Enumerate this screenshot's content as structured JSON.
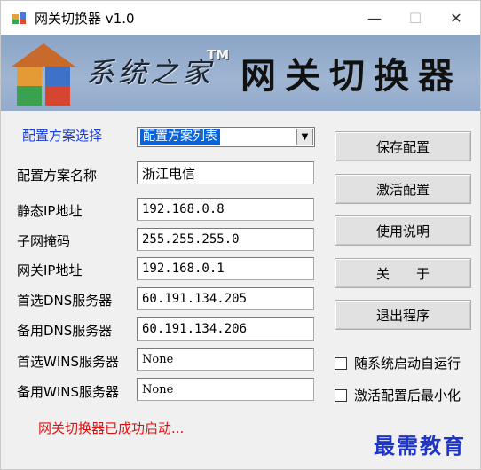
{
  "window": {
    "title": "网关切换器 v1.0",
    "controls": {
      "minimize": "—",
      "maximize": "☐",
      "close": "✕"
    }
  },
  "banner": {
    "brand": "系统之家",
    "tm": "TM",
    "title": "网关切换器"
  },
  "form": {
    "scheme_select_label": "配置方案选择",
    "scheme_select_value": "配置方案列表",
    "fields": [
      {
        "label": "配置方案名称",
        "value": "浙江电信"
      },
      {
        "label": "静态IP地址",
        "value": "192.168.0.8"
      },
      {
        "label": "子网掩码",
        "value": "255.255.255.0"
      },
      {
        "label": "网关IP地址",
        "value": "192.168.0.1"
      },
      {
        "label": "首选DNS服务器",
        "value": "60.191.134.205"
      },
      {
        "label": "备用DNS服务器",
        "value": "60.191.134.206"
      },
      {
        "label": "首选WINS服务器",
        "value": "None"
      },
      {
        "label": "备用WINS服务器",
        "value": "None"
      }
    ]
  },
  "buttons": {
    "save": "保存配置",
    "activate": "激活配置",
    "help": "使用说明",
    "about": "关　　于",
    "exit": "退出程序"
  },
  "options": {
    "autostart": {
      "label": "随系统启动自运行",
      "checked": false
    },
    "minimize_after": {
      "label": "激活配置后最小化",
      "checked": false
    }
  },
  "status": "网关切换器已成功启动...",
  "watermark": "最需教育",
  "colors": {
    "banner_bg": "#9fb5d2",
    "label_blue": "#1a3fd6",
    "status_red": "#e01010",
    "selection_blue": "#0a64d8",
    "watermark_blue": "#1e35c8"
  }
}
